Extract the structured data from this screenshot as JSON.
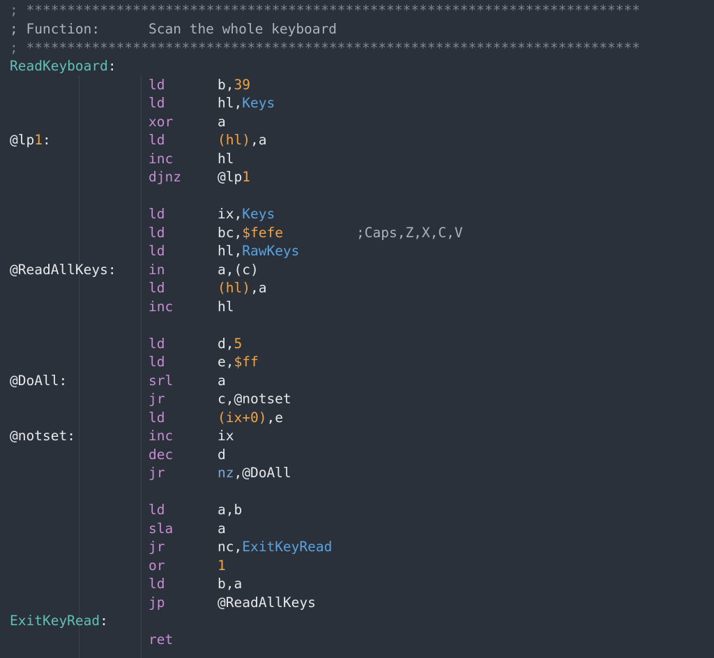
{
  "header": {
    "star_line_1": "; ***************************************************************************",
    "function_prefix": "; Function:",
    "function_text": "Scan the whole keyboard",
    "star_line_2": "; ***************************************************************************"
  },
  "lines": [
    {
      "label": "ReadKeyboard",
      "label_type": "global",
      "colon": ":"
    },
    {
      "op": "ld",
      "arg": [
        {
          "t": "b,",
          "c": "reg"
        },
        {
          "t": "39",
          "c": "num"
        }
      ]
    },
    {
      "op": "ld",
      "arg": [
        {
          "t": "hl,",
          "c": "reg"
        },
        {
          "t": "Keys",
          "c": "sym"
        }
      ]
    },
    {
      "op": "xor",
      "arg": [
        {
          "t": "a",
          "c": "reg"
        }
      ]
    },
    {
      "label": "@lp",
      "label_num": "1",
      "label_type": "local",
      "colon": ":",
      "op": "ld",
      "arg": [
        {
          "t": "(hl)",
          "c": "paren"
        },
        {
          "t": ",a",
          "c": "reg"
        }
      ]
    },
    {
      "op": "inc",
      "arg": [
        {
          "t": "hl",
          "c": "reg"
        }
      ]
    },
    {
      "op": "djnz",
      "arg": [
        {
          "t": "@lp",
          "c": "reg"
        },
        {
          "t": "1",
          "c": "num"
        }
      ]
    },
    {},
    {
      "op": "ld",
      "arg": [
        {
          "t": "ix,",
          "c": "reg"
        },
        {
          "t": "Keys",
          "c": "sym"
        }
      ]
    },
    {
      "op": "ld",
      "arg": [
        {
          "t": "bc,",
          "c": "reg"
        },
        {
          "t": "$fefe",
          "c": "num"
        }
      ],
      "comment": ";Caps,Z,X,C,V"
    },
    {
      "op": "ld",
      "arg": [
        {
          "t": "hl,",
          "c": "reg"
        },
        {
          "t": "RawKeys",
          "c": "sym"
        }
      ]
    },
    {
      "label": "@ReadAllKeys",
      "label_type": "local",
      "colon": ":",
      "op": "in",
      "arg": [
        {
          "t": "a,(c)",
          "c": "reg"
        }
      ]
    },
    {
      "op": "ld",
      "arg": [
        {
          "t": "(hl)",
          "c": "paren"
        },
        {
          "t": ",a",
          "c": "reg"
        }
      ]
    },
    {
      "op": "inc",
      "arg": [
        {
          "t": "hl",
          "c": "reg"
        }
      ]
    },
    {},
    {
      "op": "ld",
      "arg": [
        {
          "t": "d,",
          "c": "reg"
        },
        {
          "t": "5",
          "c": "num"
        }
      ]
    },
    {
      "op": "ld",
      "arg": [
        {
          "t": "e,",
          "c": "reg"
        },
        {
          "t": "$ff",
          "c": "num"
        }
      ]
    },
    {
      "label": "@DoAll",
      "label_type": "local",
      "colon": ":",
      "op": "srl",
      "arg": [
        {
          "t": "a",
          "c": "reg"
        }
      ]
    },
    {
      "op": "jr",
      "arg": [
        {
          "t": "c,@notset",
          "c": "reg"
        }
      ]
    },
    {
      "op": "ld",
      "arg": [
        {
          "t": "(ix+0)",
          "c": "paren"
        },
        {
          "t": ",e",
          "c": "reg"
        }
      ]
    },
    {
      "label": "@notset",
      "label_type": "local",
      "colon": ":",
      "op": "inc",
      "arg": [
        {
          "t": "ix",
          "c": "reg"
        }
      ]
    },
    {
      "op": "dec",
      "arg": [
        {
          "t": "d",
          "c": "reg"
        }
      ]
    },
    {
      "op": "jr",
      "arg": [
        {
          "t": "nz",
          "c": "cond"
        },
        {
          "t": ",@DoAll",
          "c": "reg"
        }
      ]
    },
    {},
    {
      "op": "ld",
      "arg": [
        {
          "t": "a,b",
          "c": "reg"
        }
      ]
    },
    {
      "op": "sla",
      "arg": [
        {
          "t": "a",
          "c": "reg"
        }
      ]
    },
    {
      "op": "jr",
      "arg": [
        {
          "t": "nc,",
          "c": "reg"
        },
        {
          "t": "ExitKeyRead",
          "c": "sym"
        }
      ]
    },
    {
      "op": "or",
      "arg": [
        {
          "t": "1",
          "c": "num"
        }
      ]
    },
    {
      "op": "ld",
      "arg": [
        {
          "t": "b,a",
          "c": "reg"
        }
      ]
    },
    {
      "op": "jp",
      "arg": [
        {
          "t": "@ReadAllKeys",
          "c": "reg"
        }
      ]
    },
    {
      "label": "ExitKeyRead",
      "label_type": "global",
      "colon": ":"
    },
    {
      "op": "ret"
    }
  ],
  "colors": {
    "background": "#2b313a",
    "opcode": "#c78cd3",
    "number": "#f0a445",
    "symbol": "#5aa2e0",
    "global_label": "#60c0b8",
    "comment": "#aab4be"
  }
}
